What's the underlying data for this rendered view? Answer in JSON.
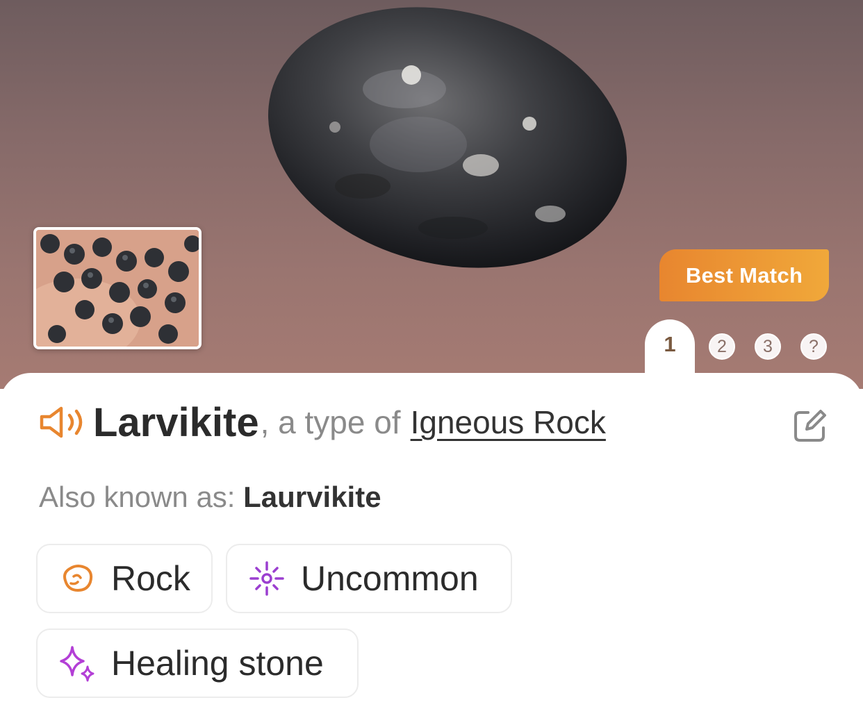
{
  "hero": {
    "badge_label": "Best Match",
    "pager": {
      "active": "1",
      "pages": [
        "2",
        "3",
        "?"
      ]
    }
  },
  "result": {
    "name": "Larvikite",
    "type_of_text": ", a type of",
    "category": "Igneous Rock",
    "also_known_label": "Also known as:",
    "also_known_value": "Laurvikite"
  },
  "tags": [
    {
      "label": "Rock",
      "icon": "rock-icon",
      "color": "#e8862f"
    },
    {
      "label": "Uncommon",
      "icon": "rarity-sparkle-icon",
      "color": "#9b3fd0"
    },
    {
      "label": "Healing stone",
      "icon": "healing-sparkle-icon",
      "color": "#b33fd6"
    }
  ],
  "colors": {
    "accent_orange": "#e8862f",
    "badge_gradient_end": "#f0a83a",
    "text_dark": "#2b2b2b",
    "text_muted": "#8a8a8a"
  }
}
